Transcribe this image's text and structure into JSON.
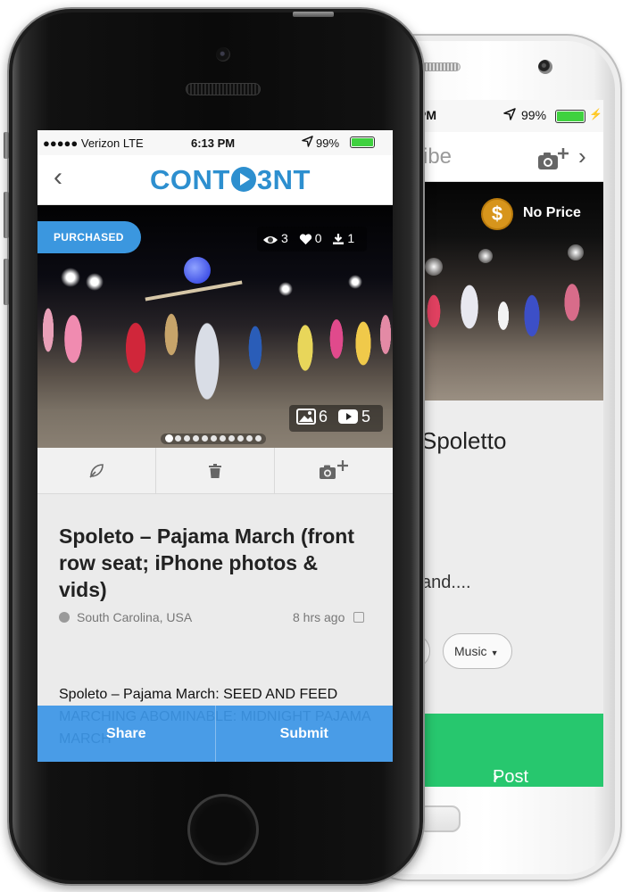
{
  "back_phone": {
    "status": {
      "time": "PM",
      "battery": "99%"
    },
    "nav": {
      "title_fragment": "ribe"
    },
    "price": {
      "badge_symbol": "$",
      "label": "No Price"
    },
    "title_fragment": "Spoletto",
    "body_fragment": "and....",
    "pill_category": "Music",
    "post_button": "Post"
  },
  "front_phone": {
    "status": {
      "carrier": "●●●●● Verizon  LTE",
      "time": "6:13 PM",
      "battery": "99%"
    },
    "nav": {
      "back_symbol": "‹",
      "logo_pre": "CONT",
      "logo_mid": "3",
      "logo_post": "NT"
    },
    "photo": {
      "badge": "PURCHASED",
      "views": "3",
      "likes": "0",
      "downloads": "1",
      "photo_count": "6",
      "video_count": "5",
      "page_dots_total": 11,
      "page_dot_active": 1
    },
    "post": {
      "title": "Spoleto – Pajama March (front row seat; iPhone photos & vids)",
      "location": "South Carolina, USA",
      "time_ago": "8 hrs ago",
      "description": "Spoleto – Pajama March: SEED AND FEED MARCHING ABOMINABLE: MIDNIGHT PAJAMA MARCH"
    },
    "bottom_bar": {
      "share": "Share",
      "submit": "Submit"
    }
  },
  "colors": {
    "brand_blue": "#2d8fcf",
    "purchased_badge": "#3b97df",
    "bottom_bar": "#3c96e6",
    "post_green": "#27c76e",
    "price_gold": "#d7951c",
    "battery_green": "#3fd13f"
  }
}
